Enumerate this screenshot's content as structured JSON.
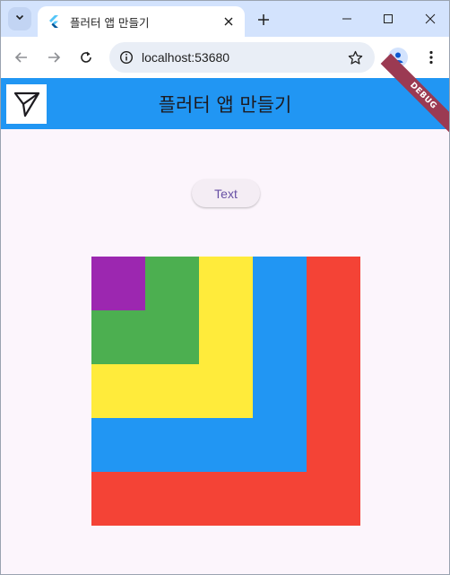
{
  "browser": {
    "tab": {
      "title": "플러터 앱 만들기",
      "favicon": "flutter-icon"
    },
    "address_bar": {
      "url": "localhost:53680"
    },
    "icons": {
      "tab_search": "chevron-down-icon",
      "tab_close": "close-icon",
      "new_tab": "plus-icon",
      "minimize": "minimize-icon",
      "maximize": "maximize-icon",
      "close": "close-icon",
      "back": "arrow-left-icon",
      "forward": "arrow-right-icon",
      "reload": "reload-icon",
      "site_info": "info-icon",
      "bookmark": "star-icon",
      "profile": "person-icon",
      "menu": "kebab-menu-icon"
    }
  },
  "app": {
    "appbar": {
      "title": "플러터 앱 만들기",
      "logo_icon": "send-icon",
      "background": "#2196f3"
    },
    "debug_banner": "DEBUG",
    "button": {
      "label": "Text"
    },
    "nested_boxes": [
      {
        "name": "red",
        "color": "#f44336"
      },
      {
        "name": "blue",
        "color": "#2196f3"
      },
      {
        "name": "yellow",
        "color": "#ffeb3b"
      },
      {
        "name": "green",
        "color": "#4caf50"
      },
      {
        "name": "purple",
        "color": "#9c27b0"
      }
    ]
  }
}
